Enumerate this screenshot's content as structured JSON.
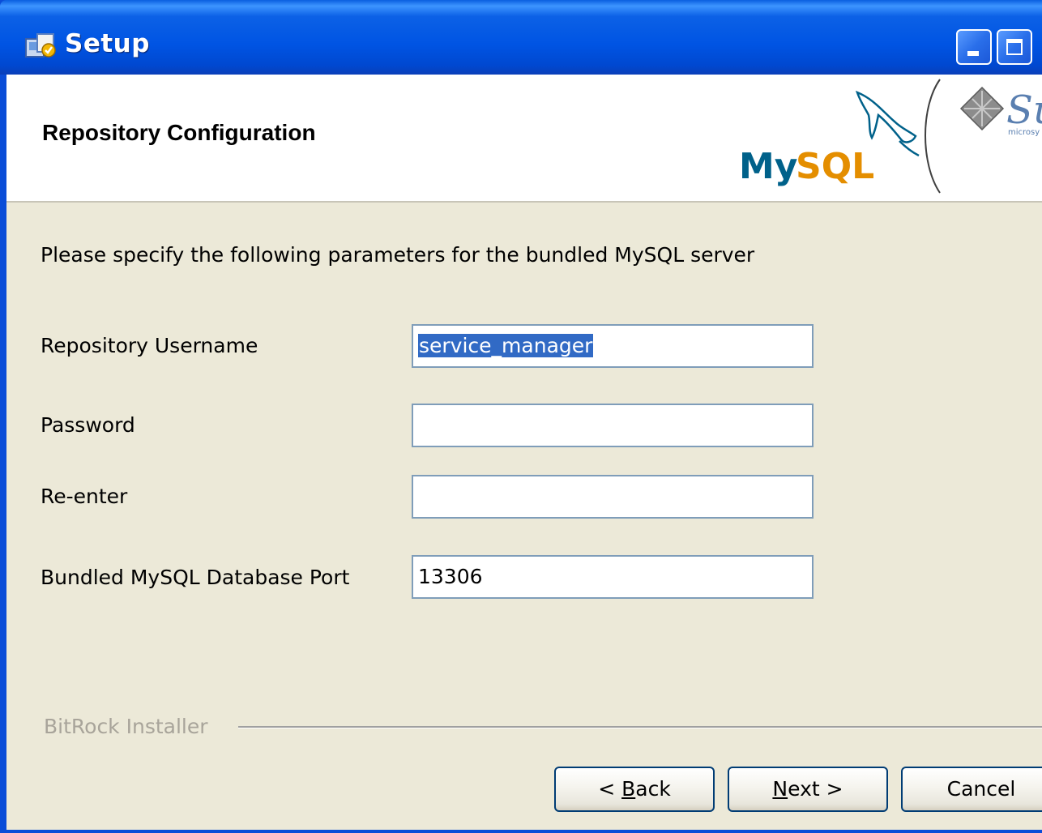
{
  "window": {
    "title": "Setup",
    "title_icon": "setup-app-icon",
    "controls": [
      "minimize",
      "maximize"
    ]
  },
  "header": {
    "title": "Repository Configuration",
    "logos": {
      "mysql": {
        "text": "MySQL",
        "brand_color": "#00618A",
        "accent_color": "#E48E00"
      },
      "sun": {
        "text": "Su",
        "subtext": "microsy"
      }
    }
  },
  "form": {
    "intro": "Please specify the following parameters for the bundled MySQL server",
    "fields": [
      {
        "label": "Repository Username",
        "value": "service_manager",
        "selected": true
      },
      {
        "label": "Password",
        "value": ""
      },
      {
        "label": "Re-enter",
        "value": ""
      },
      {
        "label": "Bundled MySQL Database Port",
        "value": "13306"
      }
    ]
  },
  "footer": {
    "installer_label": "BitRock Installer",
    "buttons": {
      "back": {
        "prefix": "< ",
        "mnemonic": "B",
        "rest": "ack"
      },
      "next": {
        "mnemonic": "N",
        "rest": "ext >"
      },
      "cancel": {
        "label": "Cancel"
      }
    }
  },
  "colors": {
    "titlebar": "#0054E3",
    "dialog_bg": "#ECE9D8",
    "selection": "#316AC5",
    "field_border": "#7F9DB9",
    "button_border": "#003C74"
  }
}
